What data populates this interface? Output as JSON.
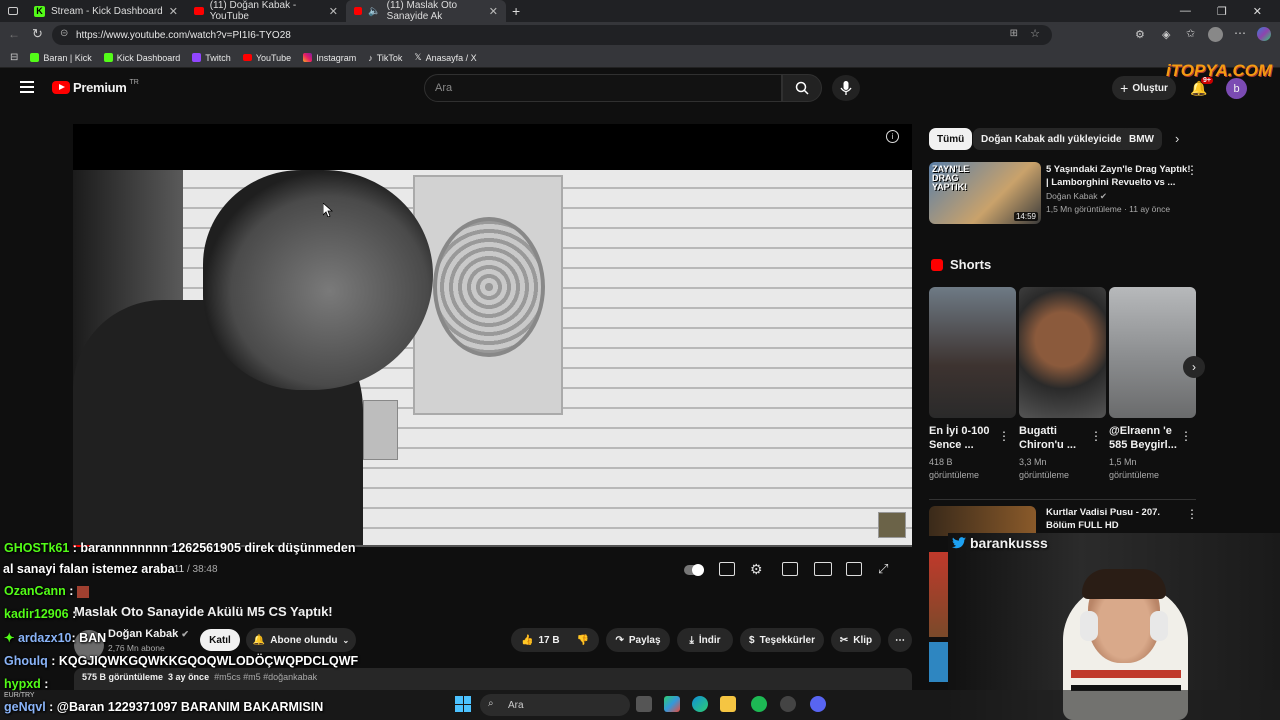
{
  "browser": {
    "tabs": [
      {
        "title": "Stream - Kick Dashboard",
        "icon": "kick-icon"
      },
      {
        "title": "(11) Doğan Kabak - YouTube",
        "icon": "youtube-icon"
      },
      {
        "title": "(11) Maslak Oto Sanayide Ak",
        "icon": "youtube-icon"
      }
    ],
    "url": "https://www.youtube.com/watch?v=PI1I6-TYO28",
    "bookmarks": [
      "Baran | Kick",
      "Kick Dashboard",
      "Twitch",
      "YouTube",
      "Instagram",
      "TikTok",
      "Anasayfa / X"
    ]
  },
  "youtube": {
    "logo": "Premium",
    "logo_sup": "TR",
    "search_placeholder": "Ara",
    "create_label": "Oluştur",
    "notif_count": "9+",
    "avatar_letter": "b",
    "watermark": "iTOPYA.COM"
  },
  "player": {
    "time_current": ":11",
    "time_total": "/ 38:48"
  },
  "video": {
    "title": "Maslak Oto Sanayide Akülü M5 CS Yaptık!",
    "channel": "Doğan Kabak",
    "subs": "2,76 Mn abone",
    "join_label": "Katıl",
    "subscribed_label": "Abone olundu",
    "likes": "17 B",
    "share_label": "Paylaş",
    "download_label": "İndir",
    "thanks_label": "Teşekkürler",
    "clip_label": "Klip",
    "views": "575 B görüntüleme",
    "age": "3 ay önce",
    "tags": "#m5cs #m5 #doğankabak"
  },
  "sidebar": {
    "chips": [
      "Tümü",
      "Doğan Kabak adlı yükleyiciden",
      "BMW"
    ],
    "rec1": {
      "title_line1": "5 Yaşındaki Zayn'le Drag Yaptık!",
      "title_line2": "| Lamborghini Revuelto vs ...",
      "channel": "Doğan Kabak",
      "meta": "1,5 Mn görüntüleme · 11 ay önce",
      "duration": "14:59",
      "thumb_text": "ZAYN'LE DRAG YAPTIK!"
    },
    "shorts_label": "Shorts",
    "shorts": [
      {
        "t1": "En İyi 0-100",
        "t2": "Sence ...",
        "v1": "418 B",
        "v2": "görüntüleme"
      },
      {
        "t1": "Bugatti",
        "t2": "Chiron'u ...",
        "v1": "3,3 Mn",
        "v2": "görüntüleme"
      },
      {
        "t1": "@Elraenn  'e",
        "t2": "585 Beygirl...",
        "v1": "1,5 Mn",
        "v2": "görüntüleme"
      }
    ],
    "rec2": {
      "title_line1": "Kurtlar Vadisi Pusu - 207.",
      "title_line2": "Bölüm FULL HD"
    }
  },
  "chat": [
    {
      "user": "GHOSTk61",
      "msg": ": barannnnnnnn 1262561905 direk düşünmeden"
    },
    {
      "user": "",
      "msg": "al sanayi falan istemez araba"
    },
    {
      "user": "OzanCann",
      "msg": ":"
    },
    {
      "user": "kadir12906",
      "msg": ":"
    },
    {
      "user": "ardazx10",
      "msg": ": BAN"
    },
    {
      "user": "Ghoulq",
      "msg": ": KQGJIQWKGQWKKGQOQWLODÖÇWQPDCLQWF"
    },
    {
      "user": "hypxd",
      "msg": ":"
    },
    {
      "user": "geNqvl",
      "msg": ": @Baran 1229371097 BARANIM BAKARMISIN"
    }
  ],
  "cam": {
    "handle": "barankusss"
  },
  "taskbar": {
    "search": "Ara",
    "ticker": "EUR/TRY"
  },
  "colors": {
    "kick_green": "#53fc18",
    "yt_red": "#ff0000",
    "bg": "#0f0f0f"
  }
}
